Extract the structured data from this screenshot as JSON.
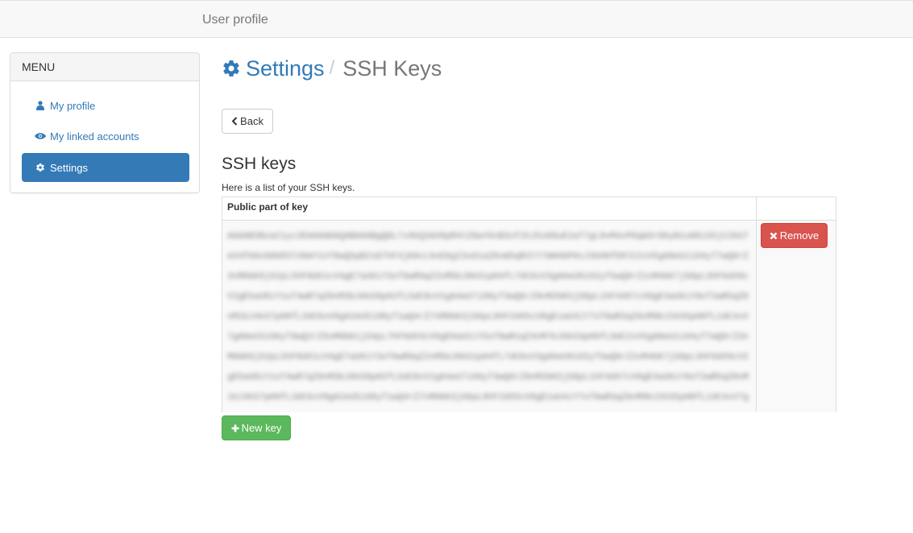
{
  "navbar": {
    "brand": "User profile"
  },
  "sidebar": {
    "heading": "MENU",
    "items": [
      {
        "label": "My profile",
        "icon": "user-icon",
        "active": false
      },
      {
        "label": "My linked accounts",
        "icon": "eye-icon",
        "active": false
      },
      {
        "label": "Settings",
        "icon": "gear-icon",
        "active": true
      }
    ]
  },
  "header": {
    "parent": "Settings",
    "separator": "/",
    "current": "SSH Keys"
  },
  "back_button": {
    "label": "Back",
    "icon": "chevron-left-icon"
  },
  "ssh_section": {
    "title": "SSH keys",
    "description": "Here is a list of your SSH keys.",
    "column_header": "Public part of key",
    "keys": [
      {
        "public_key_masked": "AAAAB3NzaC1yc2EAAAADAQABAAABgQDL7x9kQ2mV8pR4tZ0wY6nB3cF1hJ5sK8uE2aT7gL9vM4xP0qW3rD6yN1oH8iS5jC2bU7eX4fA9zG0kR3lV6mY1nT8wQ5pB2sD7hF4jK0cL9xE6gI3uO1aZ8vW5qR2tY7mN4bP0sJ3kH6fD9lC2xV5gA8eU1iO4yT7wQ0rZ3nM6bK9jS2pL5hF8dX1cV4gE7aU0iY3oT6wR9qZ2nM5bJ8kS1pH4fL7dC0xV3gA6eU9iO2yT5wQ8rZ1nM4bK7jS0pL3hF6dX9cV2gE5aU8iY1oT4wR7qZ0nM3bJ6kS9pH2fL5dC8xV1gA4eU7iO0yT3wQ6rZ9nM2bK5jS8pL1hF4dX7cV0gE3aU6iY9oT2wR5qZ8nM1bJ4kS7pH0fL3dC6xV9gA2eU5iO8yT1wQ4rZ7nM0bK3jS6pL9hF2dX5cV8gE1aU4iY7oT0wR3qZ6nM9bJ2kS5pH8fL1dC4xV7gA0eU3iO6yT9wQ2rZ5nM8bK1jS4pL7hF0dX3cV6gE9aU2iY5oT8wR1qZ4nM7bJ0kS3pH6fL9dC2xV5gA8eU1iO4yT7wQ0rZ3nM6bK9jS2pL5hF8dX1cV4gE7aU0iY3oT6wR9qZ2nM5bJ8kS1pH4fL7dC0xV3gA6eU9iO2yT5wQ8rZ1nM4bK7jS0pL3hF6dX9cV2gE5aU8iY1oT4wR7qZ0nM3bJ6kS9pH2fL5dC8xV1gA4eU7iO0yT3wQ6rZ9nM2bK5jS8pL1hF4dX7cV0gE3aU6iY9oT2wR5qZ8nM1bJ4kS7pH0fL3dC6xV9gA2eU5iO8yT1wQ4rZ7nM0bK3jS6pL9hF2dX5cV8gE1aU4iY7oT0wR3qZ6nM9bJ2kS5pH8fL1dC4xV7gA0eU3iO6yT9wQ2rZ5nM8bK1jS4pL7hF0dX3cV6gE9aU2iY5oT8wR1qZ4nM7bJ0kS3pH6fL9dC2xV5gA8eU1iO4yT7wQ0rZ3nM6bK9jS2pL5hF8dX1cV4gE7aU0iY3oT6wR9qZ2nM5bJ8kS1pH4fL7dC0xV3gA6eU9iO2yT5wQ8rZ1nM4bK7jS0pL3hF6dX9cV2gE5aU8iY1oT4wR7qZ0nM3bJ6kS9pH2fL5dC8xV1gA4eU7iO0yT3wQ6rZ9nM2bK5jS8pL1hF4dX7cV0gE3aU6iY9oT2wR5qZ8nM1bJ4kS7pH0fL3dC6xV9gA2eU5iO8yT1wQ4rZ7nM0bK3jS6pL9hF2dX5cV8gE1aU4iY7oT0wR3qZ6nM9bJ2kS5pH8fL1dC4xV7gA0eU3iO6yT9w== user@host",
        "remove_label": "Remove"
      }
    ],
    "new_key_label": "New key"
  },
  "colors": {
    "primary": "#337ab7",
    "danger": "#d9534f",
    "success": "#5cb85c",
    "muted": "#777777"
  }
}
